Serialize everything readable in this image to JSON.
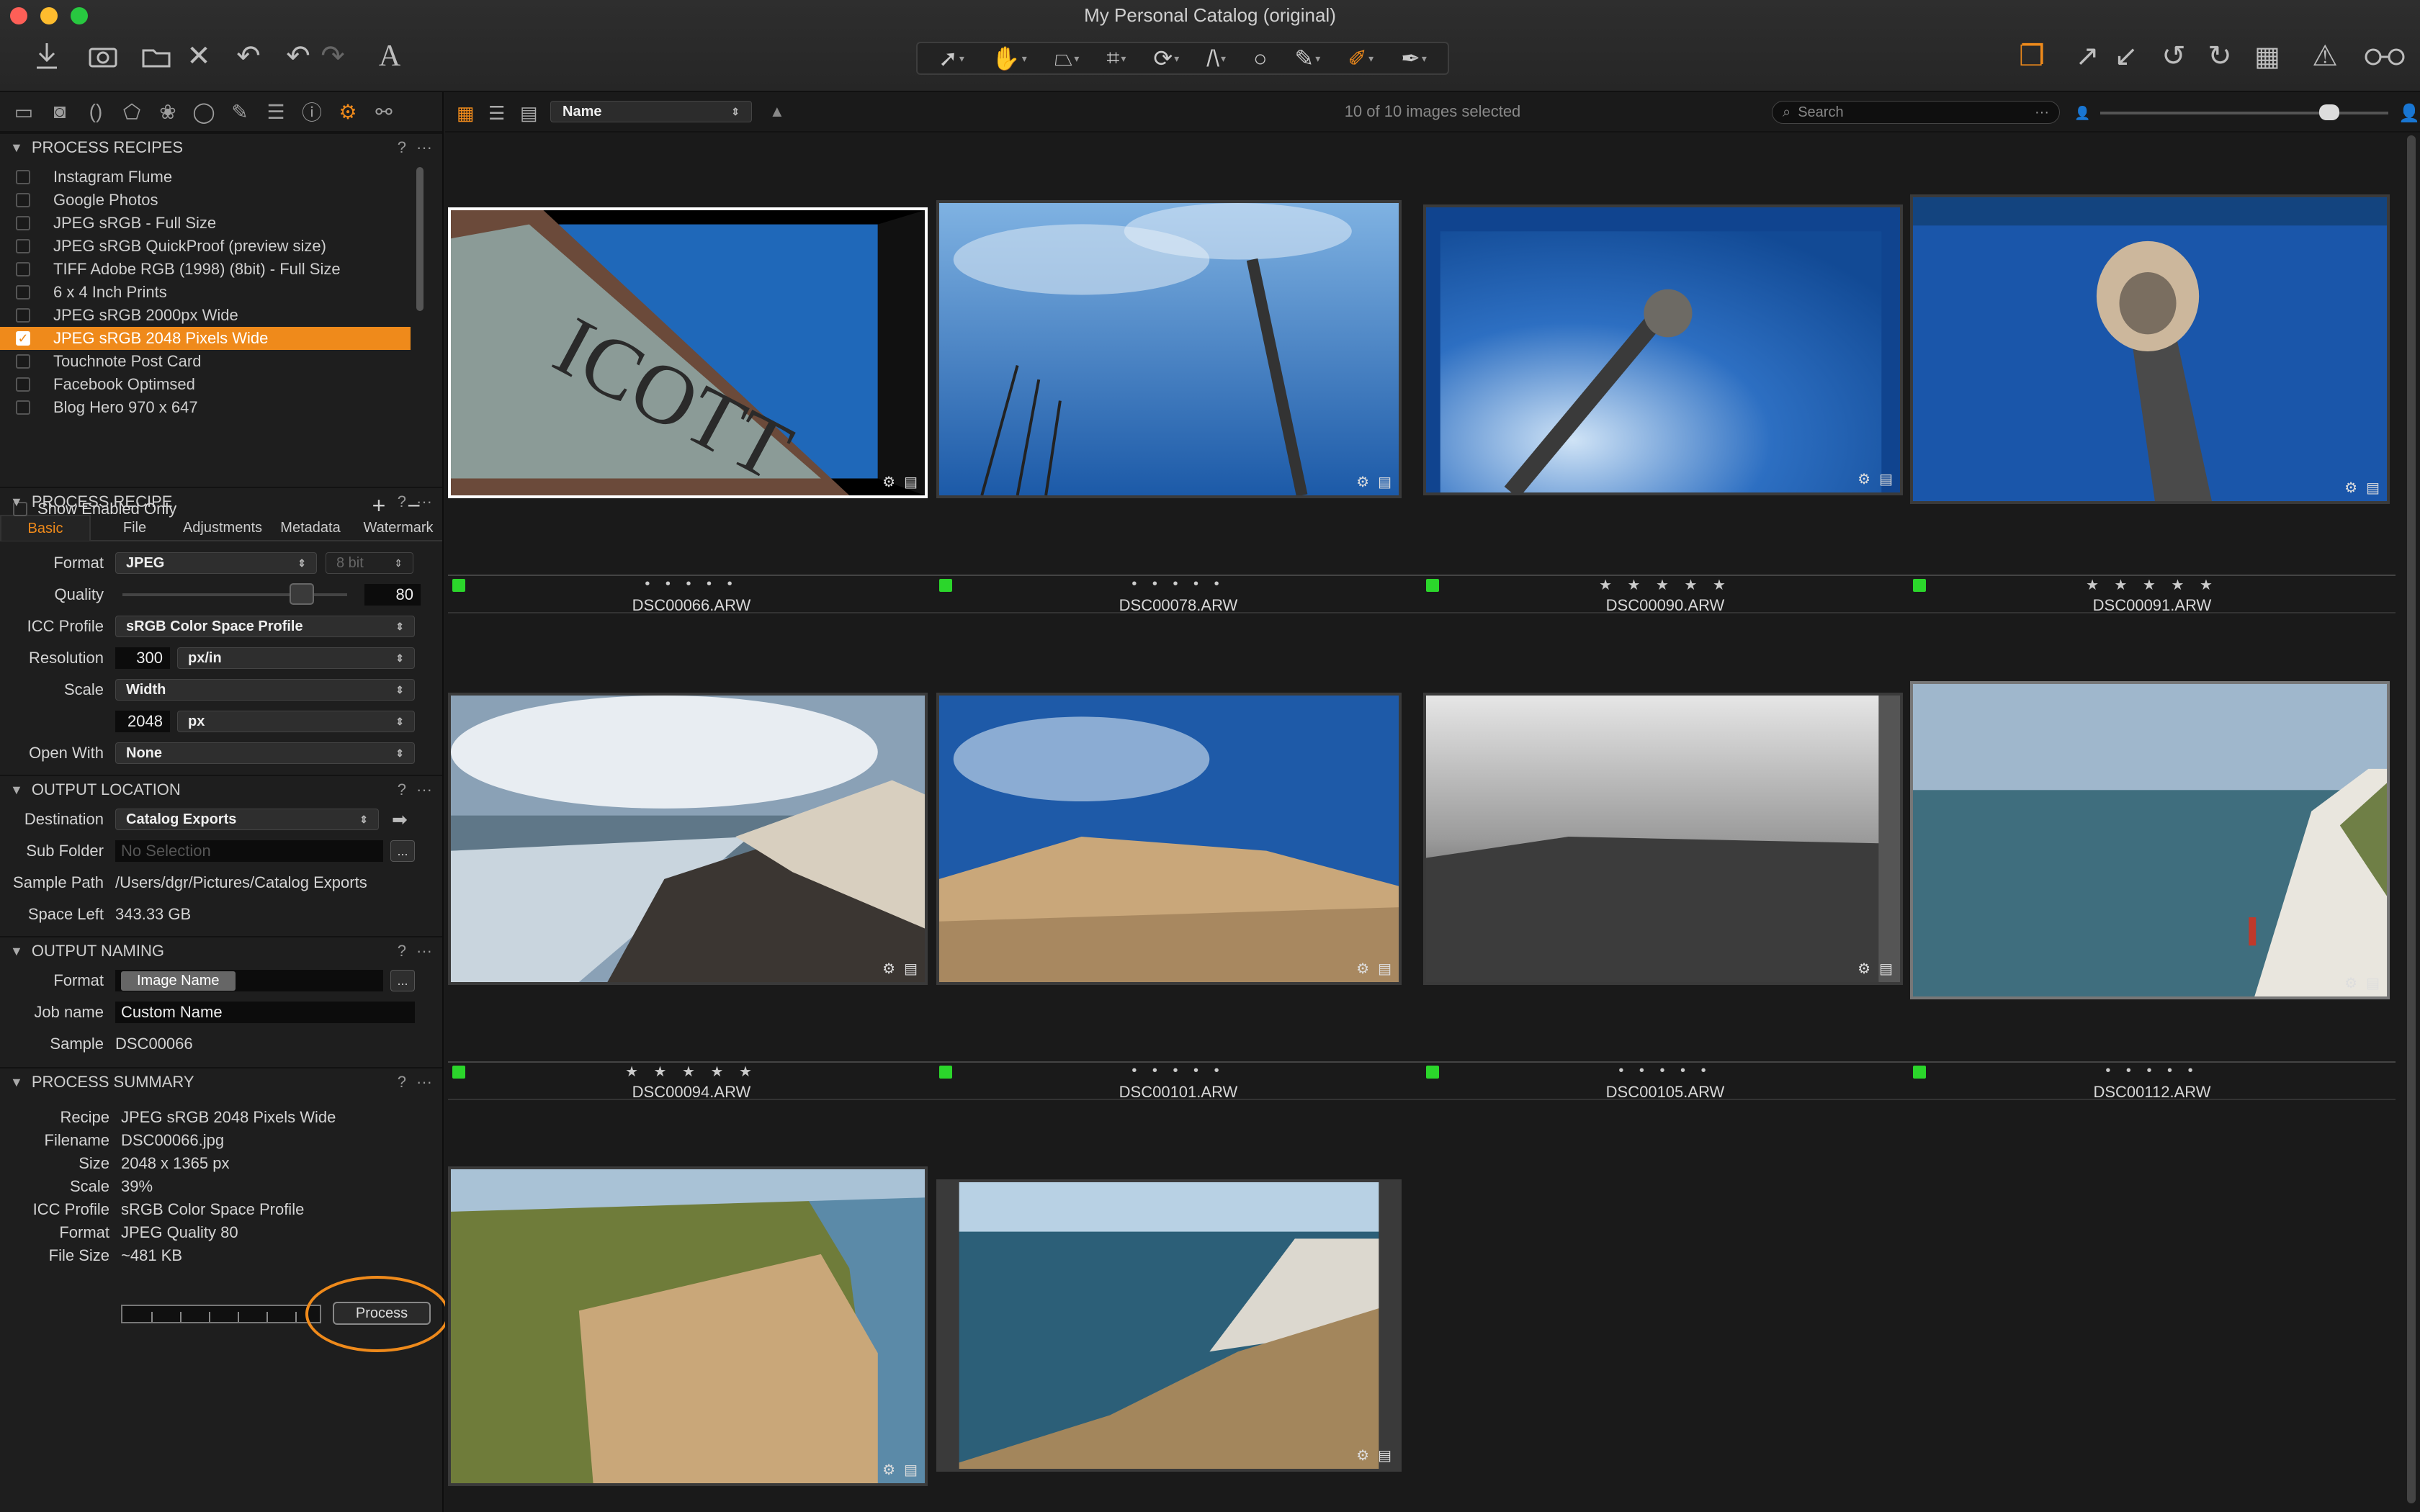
{
  "window": {
    "title": "My Personal Catalog (original)"
  },
  "left_panel": {
    "process_recipes": {
      "title": "PROCESS RECIPES",
      "items": [
        {
          "label": "Instagram Flume",
          "checked": false
        },
        {
          "label": "Google Photos",
          "checked": false
        },
        {
          "label": "JPEG sRGB - Full Size",
          "checked": false
        },
        {
          "label": "JPEG sRGB QuickProof (preview size)",
          "checked": false
        },
        {
          "label": "TIFF Adobe RGB (1998) (8bit) - Full Size",
          "checked": false
        },
        {
          "label": "6 x 4 Inch Prints",
          "checked": false
        },
        {
          "label": "JPEG sRGB 2000px Wide",
          "checked": false
        },
        {
          "label": "JPEG sRGB 2048 Pixels Wide",
          "checked": true
        },
        {
          "label": "Touchnote Post Card",
          "checked": false
        },
        {
          "label": "Facebook Optimsed",
          "checked": false
        },
        {
          "label": "Blog Hero 970 x 647",
          "checked": false
        }
      ],
      "show_enabled_only": "Show Enabled Only"
    },
    "process_recipe": {
      "title": "PROCESS RECIPE",
      "tabs": [
        "Basic",
        "File",
        "Adjustments",
        "Metadata",
        "Watermark"
      ],
      "format_label": "Format",
      "format_value": "JPEG",
      "bitdepth": "8 bit",
      "quality_label": "Quality",
      "quality_value": "80",
      "icc_label": "ICC Profile",
      "icc_value": "sRGB Color Space Profile",
      "resolution_label": "Resolution",
      "resolution_value": "300",
      "resolution_unit": "px/in",
      "scale_label": "Scale",
      "scale_value": "Width",
      "scale_size": "2048",
      "scale_unit": "px",
      "openwith_label": "Open With",
      "openwith_value": "None"
    },
    "output_location": {
      "title": "OUTPUT LOCATION",
      "destination_label": "Destination",
      "destination_value": "Catalog Exports",
      "subfolder_label": "Sub Folder",
      "subfolder_placeholder": "No Selection",
      "samplepath_label": "Sample Path",
      "samplepath_value": "/Users/dgr/Pictures/Catalog Exports",
      "spaceleft_label": "Space Left",
      "spaceleft_value": "343.33 GB"
    },
    "output_naming": {
      "title": "OUTPUT NAMING",
      "format_label": "Format",
      "format_token": "Image Name",
      "jobname_label": "Job name",
      "jobname_value": "Custom Name",
      "sample_label": "Sample",
      "sample_value": "DSC00066"
    },
    "process_summary": {
      "title": "PROCESS SUMMARY",
      "rows": [
        {
          "label": "Recipe",
          "value": "JPEG sRGB 2048 Pixels Wide"
        },
        {
          "label": "Filename",
          "value": "DSC00066.jpg"
        },
        {
          "label": "Size",
          "value": "2048 x 1365 px"
        },
        {
          "label": "Scale",
          "value": "39%"
        },
        {
          "label": "ICC Profile",
          "value": "sRGB Color Space Profile"
        },
        {
          "label": "Format",
          "value": "JPEG Quality 80"
        },
        {
          "label": "File Size",
          "value": "~481 KB"
        }
      ],
      "process_button": "Process"
    },
    "help": "?",
    "more": "···",
    "add": "+",
    "remove": "−",
    "ellipsis": "...",
    "arrow": "➡"
  },
  "browser": {
    "sort_label": "Name",
    "selection_count": "10 of 10 images selected",
    "search_placeholder": "Search",
    "search_more": "···",
    "images": [
      {
        "name": "DSC00066.ARW",
        "stars": "• • • • •",
        "color_tag": "green"
      },
      {
        "name": "DSC00078.ARW",
        "stars": "• • • • •",
        "color_tag": "green"
      },
      {
        "name": "DSC00090.ARW",
        "stars": "★ ★ ★ ★ ★",
        "color_tag": "green"
      },
      {
        "name": "DSC00091.ARW",
        "stars": "★ ★ ★ ★ ★",
        "color_tag": "green"
      },
      {
        "name": "DSC00094.ARW",
        "stars": "★ ★ ★ ★ ★",
        "color_tag": "green"
      },
      {
        "name": "DSC00101.ARW",
        "stars": "• • • • •",
        "color_tag": "green"
      },
      {
        "name": "DSC00105.ARW",
        "stars": "• • • • •",
        "color_tag": "green"
      },
      {
        "name": "DSC00112.ARW",
        "stars": "• • • • •",
        "color_tag": "green"
      },
      {
        "name": "",
        "stars": "",
        "color_tag": ""
      },
      {
        "name": "",
        "stars": "",
        "color_tag": ""
      }
    ]
  },
  "colors": {
    "accent": "#ef8a1b",
    "color_tag_green": "#2bd62b"
  },
  "icons": {
    "toolbar": [
      "import-icon",
      "camera-icon",
      "move-icon",
      "delete-icon",
      "undo-all-icon",
      "undo-icon",
      "redo-icon",
      "text-icon"
    ],
    "tools": [
      "cursor-tool-icon",
      "pan-tool-icon",
      "keystone-tool-icon",
      "crop-tool-icon",
      "rotate-tool-icon",
      "straighten-tool-icon",
      "circle-tool-icon",
      "brush-tool-icon",
      "eraser-tool-icon",
      "picker-tool-icon"
    ],
    "right": [
      "stack-icon",
      "export-icon",
      "import-arrow-icon",
      "rotate-left-icon",
      "rotate-right-icon",
      "grid-icon",
      "warning-icon",
      "glasses-icon"
    ],
    "tabs": [
      "library-tab-icon",
      "capture-tab-icon",
      "lens-tab-icon",
      "composition-tab-icon",
      "color-tab-icon",
      "exposure-tab-icon",
      "details-tab-icon",
      "metadata-tab-icon",
      "adjustments-tab-icon",
      "output-tab-icon",
      "batch-tab-icon"
    ]
  }
}
